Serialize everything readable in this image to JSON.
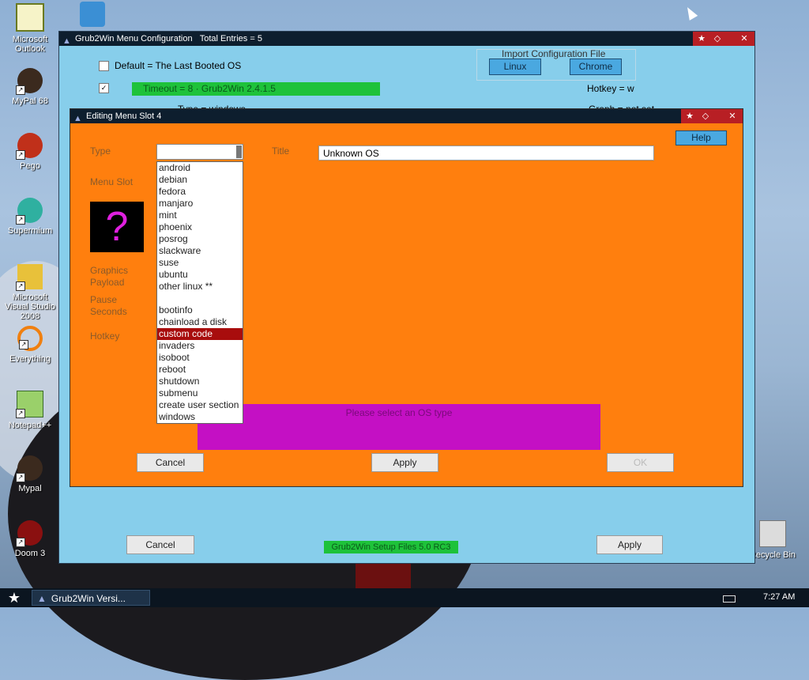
{
  "desktop": {
    "icons": [
      {
        "label": "Microsoft Outlook"
      },
      {
        "label": "MyPal 68"
      },
      {
        "label": "Pego"
      },
      {
        "label": "Supermium"
      },
      {
        "label": "Microsoft Visual Studio 2008"
      },
      {
        "label": "Everything"
      },
      {
        "label": "Notepad++"
      },
      {
        "label": "Mypal"
      },
      {
        "label": "Doom 3"
      }
    ],
    "recycle_bin": "Recycle Bin"
  },
  "main_window": {
    "title": "Grub2Win Menu Configuration",
    "entries": "Total Entries = 5",
    "default_label": "Default = The Last Booted OS",
    "import_label": "Import Configuration File",
    "import_linux": "Linux",
    "import_chrome": "Chrome",
    "green_bar_text": "Timeout = 8 · Grub2Win 2.4.1.5",
    "hotkey_label": "Hotkey = w",
    "type_row": "Type = windows",
    "graph_label": "Graph = not set",
    "cancel_label": "Cancel",
    "apply_label": "Apply",
    "bottom_green_text": "Grub2Win Setup Files 5.0 RC3"
  },
  "dialog": {
    "title": "Editing Menu Slot 4",
    "type_label": "Type",
    "title_label": "Title",
    "title_value": "Unknown OS",
    "help_label": "Help",
    "menu_slot_label": "Menu Slot",
    "graphics_label": "Graphics Payload",
    "pause_label": "Pause Seconds",
    "hotkey_label": "Hotkey",
    "purple_text": "Please select an OS type",
    "cancel_label": "Cancel",
    "apply_label": "Apply",
    "ok_label": "OK"
  },
  "type_options": {
    "linux": [
      "android",
      "debian",
      "fedora",
      "manjaro",
      "mint",
      "phoenix",
      "posrog",
      "slackware",
      "suse",
      "ubuntu",
      "other linux **"
    ],
    "other": [
      "bootinfo",
      "chainload a disk",
      "custom code",
      "invaders",
      "isoboot",
      "reboot",
      "shutdown",
      "submenu",
      "create user section",
      "windows"
    ],
    "selected": "custom code"
  },
  "taskbar": {
    "task_label": "Grub2Win   Versi...",
    "clock": "7:27 AM"
  },
  "colors": {
    "dialog_bg": "#ff7f0e",
    "main_bg": "#87ceeb",
    "selected_item": "#a80d0d",
    "purple_panel": "#c410c4",
    "green_bar": "#1ec23a"
  }
}
